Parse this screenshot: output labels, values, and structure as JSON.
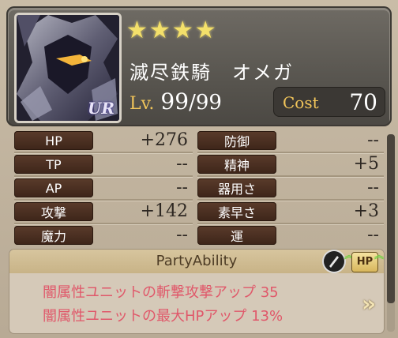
{
  "character": {
    "rarity_badge": "UR",
    "stars": [
      "★",
      "★",
      "★",
      "★"
    ],
    "name": "滅尽鉄騎　オメガ",
    "level_label": "Lv.",
    "level": "99",
    "level_max": "/99",
    "cost_label": "Cost",
    "cost": "70"
  },
  "stats": [
    {
      "label": "HP",
      "value": "+276"
    },
    {
      "label": "防御",
      "value": "--"
    },
    {
      "label": "TP",
      "value": "--"
    },
    {
      "label": "精神",
      "value": "+5"
    },
    {
      "label": "AP",
      "value": "--"
    },
    {
      "label": "器用さ",
      "value": "--"
    },
    {
      "label": "攻撃",
      "value": "+142"
    },
    {
      "label": "素早さ",
      "value": "+3"
    },
    {
      "label": "魔力",
      "value": "--"
    },
    {
      "label": "運",
      "value": "--"
    }
  ],
  "party_ability": {
    "title": "PartyAbility",
    "lines": [
      "闇属性ユニットの斬撃攻撃アップ 35",
      "闇属性ユニットの最大HPアップ 13%"
    ],
    "hp_badge": "HP",
    "up_arrow": "︽",
    "chevron": "»"
  },
  "icons": {
    "slash_icon": "slash-skill-icon",
    "hp_icon": "hp-up-icon"
  },
  "colors": {
    "accent_gold": "#f0c45a",
    "ability_text": "#e0586a"
  }
}
